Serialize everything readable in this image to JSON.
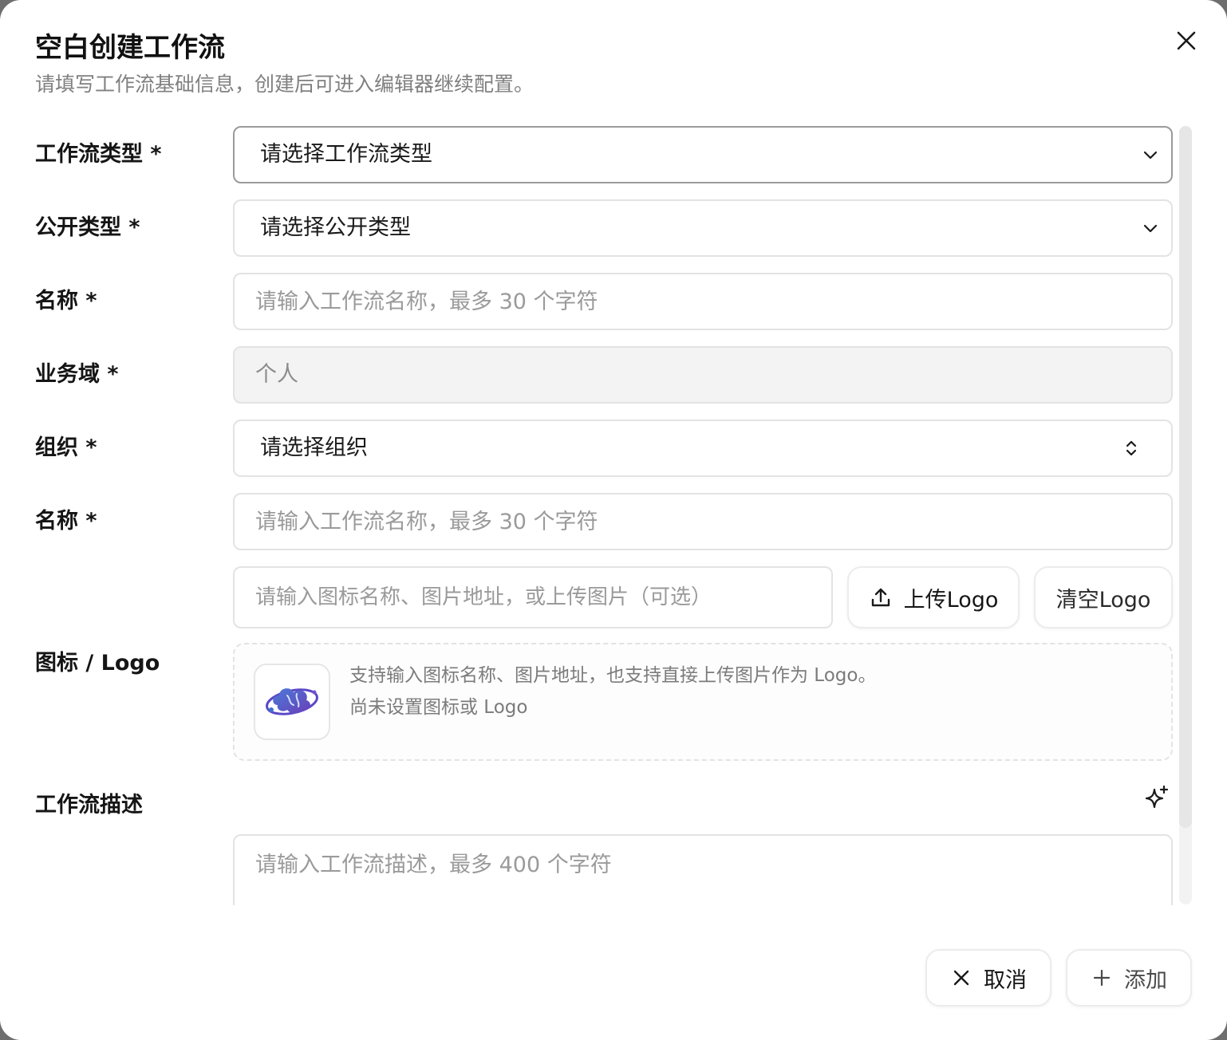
{
  "dialog": {
    "title": "空白创建工作流",
    "subtitle": "请填写工作流基础信息，创建后可进入编辑器继续配置。"
  },
  "form": {
    "workflow_type": {
      "label": "工作流类型 *",
      "value": "请选择工作流类型",
      "icon": "chevron-down-icon"
    },
    "visibility": {
      "label": "公开类型 *",
      "value": "请选择公开类型",
      "icon": "chevron-down-icon"
    },
    "name": {
      "label": "名称 *",
      "placeholder": "请输入工作流名称，最多 30 个字符"
    },
    "domain": {
      "label": "业务域 *",
      "value": "个人"
    },
    "organization": {
      "label": "组织 *",
      "value": "请选择组织",
      "icon": "chevron-up-down-icon"
    },
    "name2": {
      "label": "名称 *",
      "placeholder": "请输入工作流名称，最多 30 个字符"
    },
    "logo": {
      "label": "图标 / Logo",
      "placeholder": "请输入图标名称、图片地址，或上传图片（可选）",
      "upload_label": "上传Logo",
      "clear_label": "清空Logo",
      "hint": "支持输入图标名称、图片地址，也支持直接上传图片作为 Logo。",
      "status": "尚未设置图标或 Logo"
    },
    "description": {
      "label": "工作流描述",
      "placeholder": "请输入工作流描述，最多 400 个字符"
    }
  },
  "footer": {
    "cancel_label": "取消",
    "add_label": "添加"
  },
  "colors": {
    "text": "#151515",
    "muted": "#808080",
    "border": "#e3e3e3",
    "disabled_bg": "#f3f3f3"
  }
}
